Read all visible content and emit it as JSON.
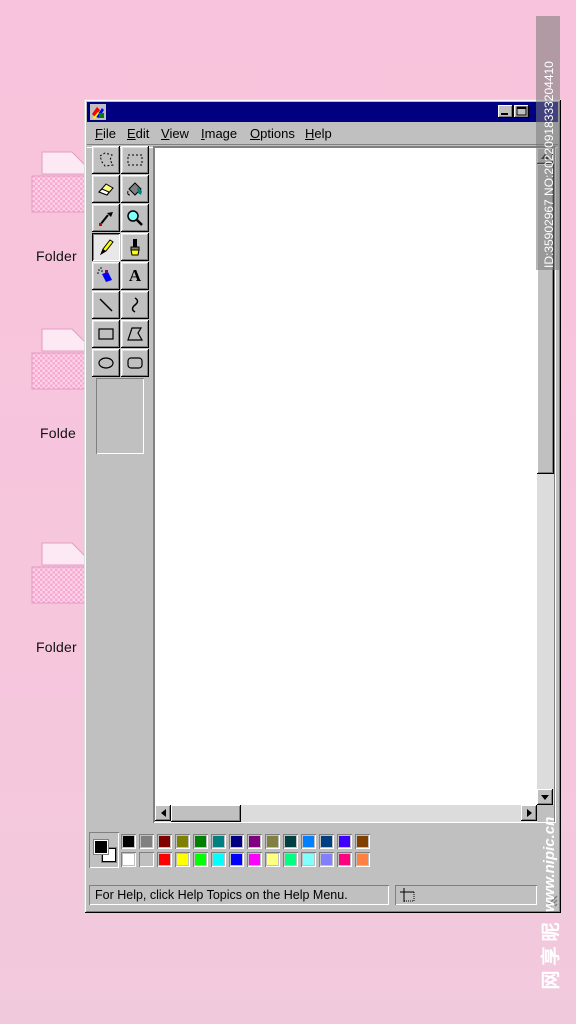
{
  "desktop": {
    "folders": [
      {
        "label": "Folder"
      },
      {
        "label": "Folde"
      },
      {
        "label": "Folder"
      }
    ]
  },
  "window": {
    "title": "",
    "menu": [
      {
        "label": "File",
        "accel": "F",
        "rest": "ile"
      },
      {
        "label": "Edit",
        "accel": "E",
        "rest": "dit"
      },
      {
        "label": "View",
        "accel": "V",
        "rest": "iew"
      },
      {
        "label": "Image",
        "accel": "I",
        "rest": "mage"
      },
      {
        "label": "Options",
        "accel": "O",
        "rest": "ptions"
      },
      {
        "label": "Help",
        "accel": "H",
        "rest": "elp"
      }
    ],
    "tools": [
      "free-form-select",
      "rectangle-select",
      "eraser",
      "fill-bucket",
      "color-picker",
      "magnifier",
      "pencil",
      "brush",
      "airbrush",
      "text",
      "line",
      "curve",
      "rectangle",
      "polygon",
      "ellipse",
      "rounded-rectangle"
    ],
    "active_tool": "pencil",
    "text_tool_glyph": "A",
    "status": {
      "help_text": "For Help, click Help Topics on the Help Menu."
    }
  },
  "palette": {
    "foreground": "#000000",
    "background": "#ffffff",
    "row1": [
      "#000000",
      "#808080",
      "#800000",
      "#808000",
      "#008000",
      "#008080",
      "#000080",
      "#800080",
      "#808040",
      "#004040",
      "#0080ff",
      "#004080",
      "#4000ff",
      "#804000"
    ],
    "row2": [
      "#ffffff",
      "#c0c0c0",
      "#ff0000",
      "#ffff00",
      "#00ff00",
      "#00ffff",
      "#0000ff",
      "#ff00ff",
      "#ffff80",
      "#00ff80",
      "#80ffff",
      "#8080ff",
      "#ff0080",
      "#ff8040"
    ]
  },
  "watermark": {
    "id_text": "ID:35902967 NO:20220918333204410",
    "url": "www.nipic.cn",
    "brand": "昵享网"
  }
}
